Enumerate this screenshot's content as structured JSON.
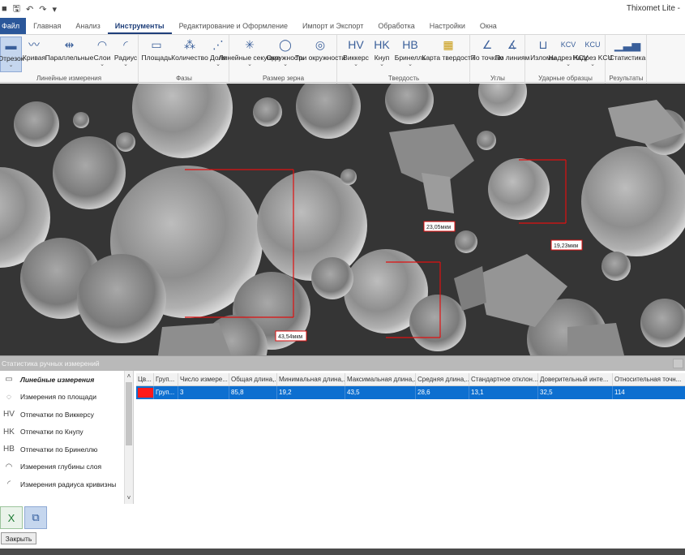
{
  "titlebar": {
    "app_title": "Thixomet Lite -"
  },
  "tabs": [
    "Файл",
    "Главная",
    "Анализ",
    "Инструменты",
    "Редактирование и Оформление",
    "Импорт и Экспорт",
    "Обработка",
    "Настройки",
    "Окна"
  ],
  "ribbon": {
    "groups": [
      {
        "caption": "Линейные измерения",
        "buttons": [
          "Отрезок",
          "Кривая",
          "Параллельные",
          "Слои",
          "Радиус"
        ]
      },
      {
        "caption": "Фазы",
        "buttons": [
          "Площадь",
          "Количество",
          "Доля"
        ]
      },
      {
        "caption": "Размер зерна",
        "buttons": [
          "Линейные секущие",
          "Окружность",
          "Три окружности"
        ]
      },
      {
        "caption": "Твердость",
        "buttons": [
          "Виккерс",
          "Кнуп",
          "Бринелль",
          "Карта твердости"
        ]
      },
      {
        "caption": "Углы",
        "buttons": [
          "По точкам",
          "По линиям"
        ]
      },
      {
        "caption": "Ударные образцы",
        "buttons": [
          "Изломы",
          "Надрез KCV",
          "Надрез KCU"
        ]
      },
      {
        "caption": "Результаты",
        "buttons": [
          "Статистика"
        ]
      }
    ]
  },
  "measurements": [
    {
      "label": "43,54мкм"
    },
    {
      "label": "23,05мкм"
    },
    {
      "label": "19,23мкм"
    }
  ],
  "panel": {
    "title": "Статистика ручных измерений",
    "categories": [
      {
        "label": "Линейные измерения",
        "icon": "ruler-icon",
        "selected": true
      },
      {
        "label": "Измерения по площади",
        "icon": "area-icon",
        "selected": false
      },
      {
        "label": "Отпечатки по Виккерсу",
        "icon": "vickers-icon",
        "selected": false
      },
      {
        "label": "Отпечатки по Кнупу",
        "icon": "knoop-icon",
        "selected": false
      },
      {
        "label": "Отпечатки по Бринеллю",
        "icon": "brinell-icon",
        "selected": false
      },
      {
        "label": "Измерения глубины слоя",
        "icon": "layer-depth-icon",
        "selected": false
      },
      {
        "label": "Измерения радиуса кривизны",
        "icon": "radius-icon",
        "selected": false
      }
    ],
    "columns": [
      "Цв...",
      "Груп...",
      "Число измере...",
      "Общая длина,...",
      "Минимальная длина,...",
      "Максимальная длина,...",
      "Средняя длина,...",
      "Стандартное отклон...",
      "Доверительный инте...",
      "Относительная точн..."
    ],
    "rows": [
      {
        "color": "#ff1a1a",
        "cells": [
          "Груп...",
          "3",
          "85,8",
          "19,2",
          "43,5",
          "28,6",
          "13,1",
          "32,5",
          "114"
        ]
      }
    ],
    "close_label": "Закрыть"
  },
  "colors": {
    "accent": "#2b579a",
    "selection": "#0d6fd0",
    "measure": "#e01010"
  }
}
